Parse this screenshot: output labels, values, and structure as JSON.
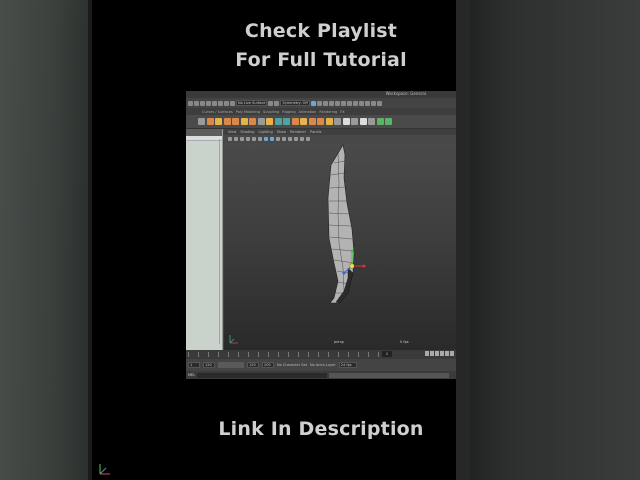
{
  "captions": {
    "line1": "Check Playlist",
    "line2": "For Full Tutorial",
    "bottom": "Link In Description"
  },
  "maya": {
    "workspace_label": "Workspace: General",
    "status_fields": [
      "No Live Surface",
      "Symmetry: Off"
    ],
    "shelf_tabs": [
      "Curves / Surfaces",
      "Poly Modeling",
      "Sculpting",
      "Rigging",
      "Animation",
      "Rendering",
      "FX",
      "FX Caching",
      "Custom"
    ],
    "panel_menu": [
      "View",
      "Shading",
      "Lighting",
      "Show",
      "Renderer",
      "Panels"
    ],
    "viewport": {
      "camera_label": "persp",
      "fps_label": "0 fps"
    },
    "timeline": {
      "current_frame": "1"
    },
    "range": {
      "start": "1",
      "playback_start": "120",
      "playback_end": "120",
      "end": "200",
      "character_set": "No Character Set",
      "anim_layer": "No Anim Layer",
      "fps": "24 fps"
    },
    "cmdline": {
      "mel_label": "MEL"
    }
  }
}
